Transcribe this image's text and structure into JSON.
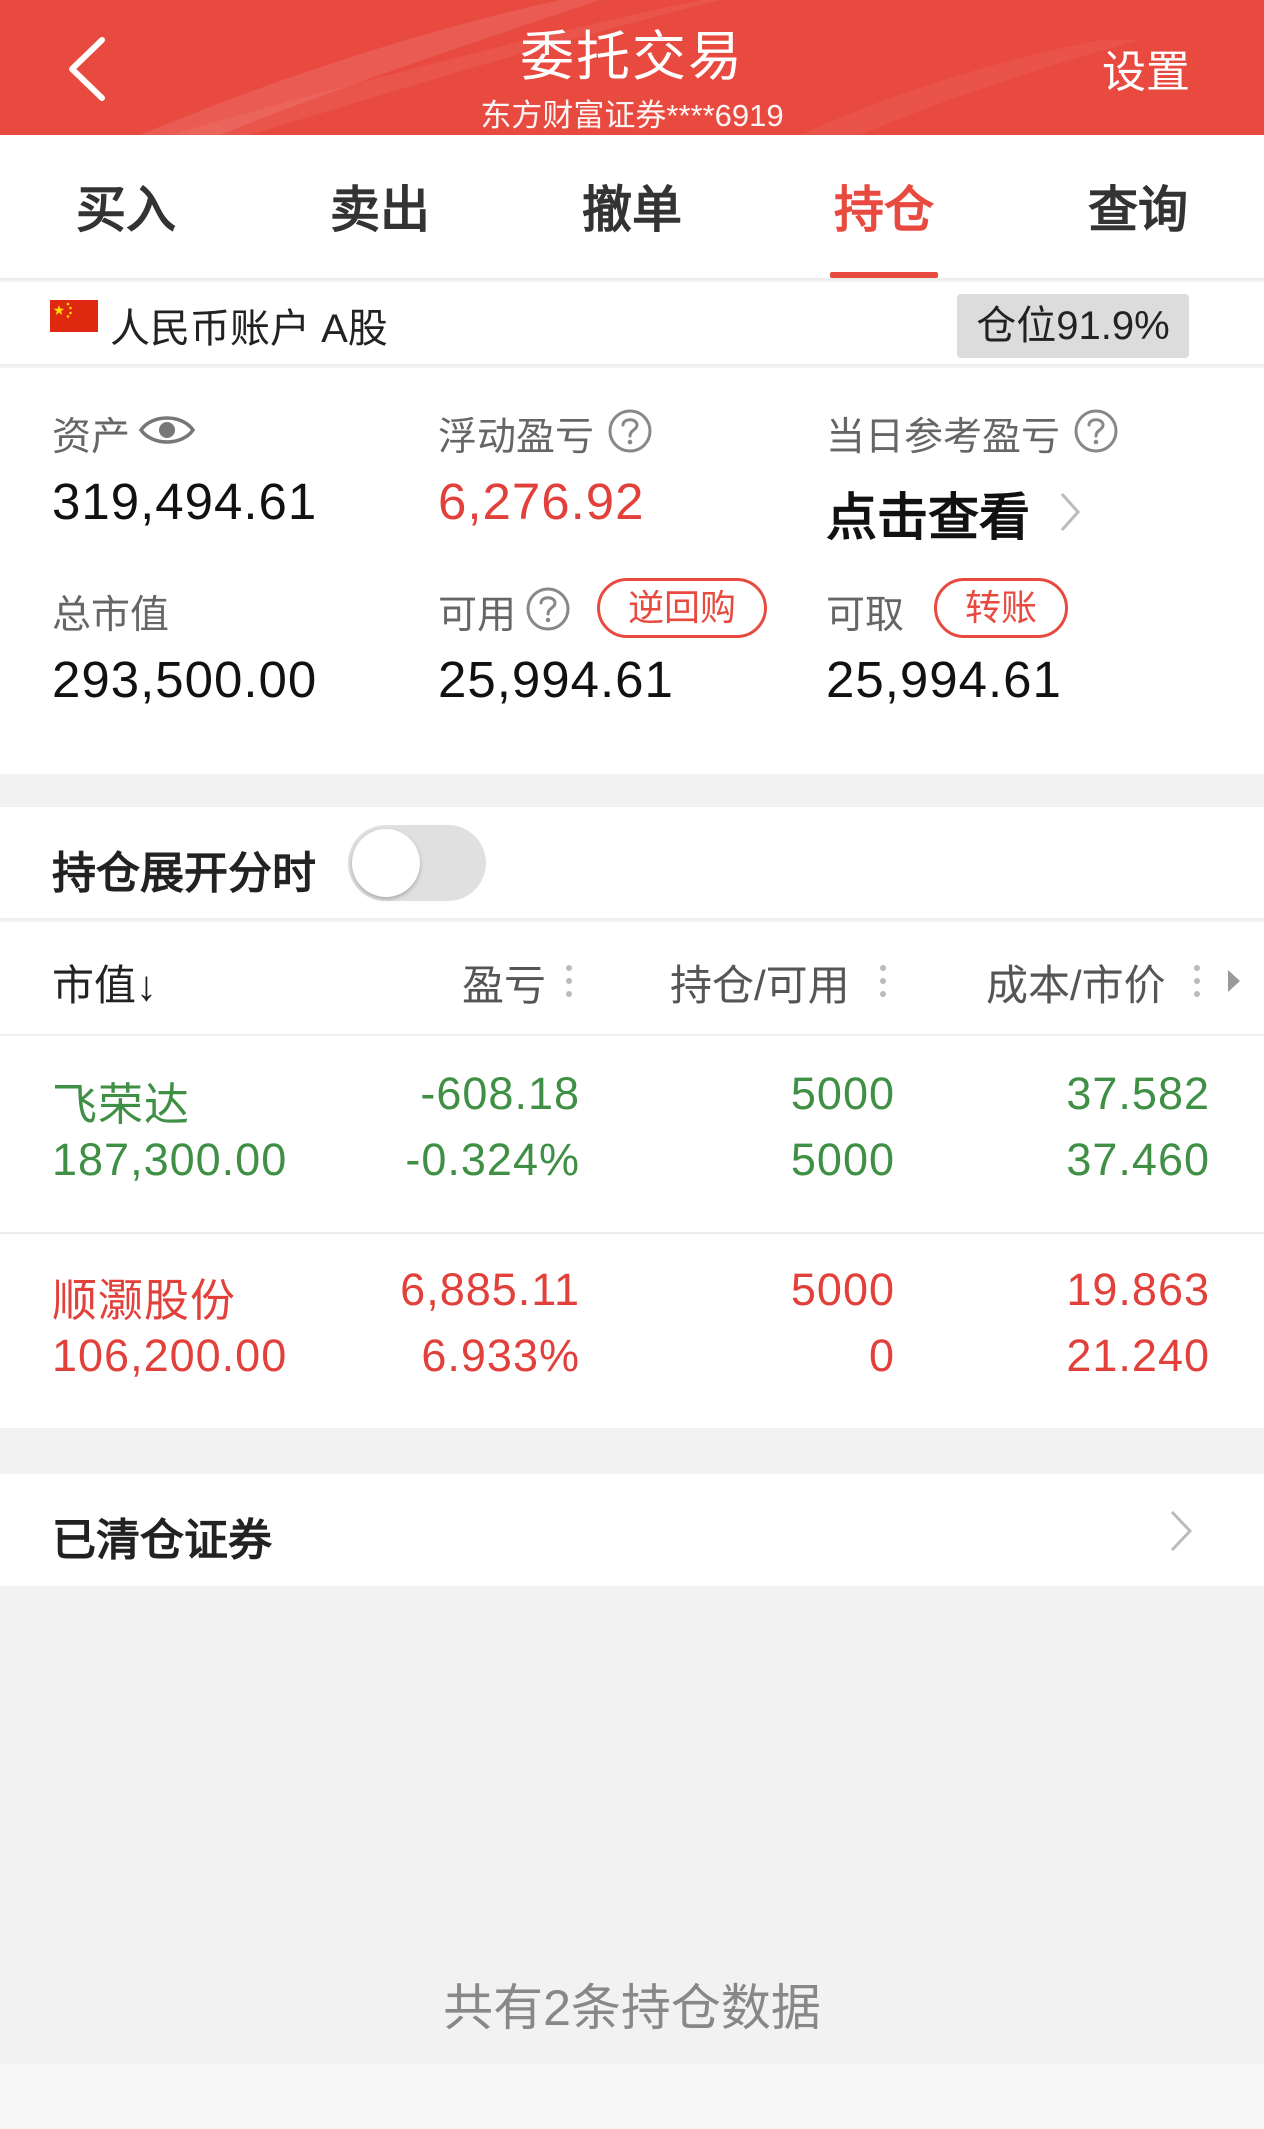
{
  "header": {
    "title": "委托交易",
    "subtitle": "东方财富证券****6919",
    "settings_label": "设置",
    "color": "#e84a40"
  },
  "tabs": [
    {
      "label": "买入",
      "active": false
    },
    {
      "label": "卖出",
      "active": false
    },
    {
      "label": "撤单",
      "active": false
    },
    {
      "label": "持仓",
      "active": true
    },
    {
      "label": "查询",
      "active": false
    }
  ],
  "account": {
    "flag_icon": "china-flag-icon",
    "label": "人民币账户 A股",
    "position_ratio": "仓位91.9%"
  },
  "assets": {
    "total_assets_label": "资产",
    "total_assets": "319,494.61",
    "floating_pnl_label": "浮动盈亏",
    "floating_pnl": "6,276.92",
    "daily_pnl_label": "当日参考盈亏",
    "daily_pnl_link": "点击查看",
    "market_value_label": "总市值",
    "market_value": "293,500.00",
    "available_label": "可用",
    "available": "25,994.61",
    "reverse_repo_label": "逆回购",
    "withdrawable_label": "可取",
    "withdrawable": "25,994.61",
    "transfer_label": "转账"
  },
  "toggle": {
    "label": "持仓展开分时",
    "on": false
  },
  "table": {
    "headers": {
      "market_value": "市值↓",
      "pnl": "盈亏",
      "holding": "持仓/可用",
      "cost_price": "成本/市价"
    },
    "rows": [
      {
        "name": "飞荣达",
        "market_value": "187,300.00",
        "pnl": "-608.18",
        "pnl_pct": "-0.324%",
        "holding": "5000",
        "available": "5000",
        "cost": "37.582",
        "price": "37.460",
        "trend": "down"
      },
      {
        "name": "顺灏股份",
        "market_value": "106,200.00",
        "pnl": "6,885.11",
        "pnl_pct": "6.933%",
        "holding": "5000",
        "available": "0",
        "cost": "19.863",
        "price": "21.240",
        "trend": "up"
      }
    ]
  },
  "cleared": {
    "label": "已清仓证券"
  },
  "footer": {
    "count_text": "共有2条持仓数据"
  },
  "colors": {
    "red": "#e2403a",
    "green": "#3f8f45"
  }
}
